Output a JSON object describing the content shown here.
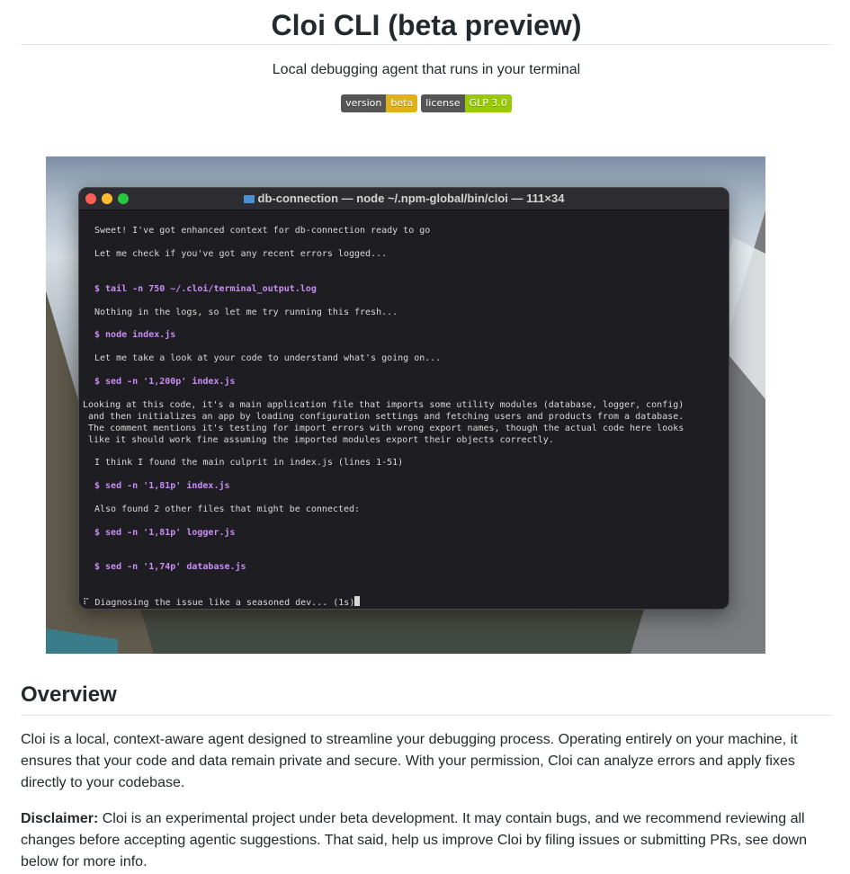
{
  "header": {
    "title": "Cloi CLI (beta preview)",
    "tagline": "Local debugging agent that runs in your terminal"
  },
  "badges": [
    {
      "label": "version",
      "value": "beta",
      "color": "#dfb317"
    },
    {
      "label": "license",
      "value": "GLP 3.0",
      "color": "#97ca00"
    }
  ],
  "terminal": {
    "title": "db-connection — node ~/.npm-global/bin/cloi — 111×34",
    "lines": [
      "Sweet! I've got enhanced context for db-connection ready to go",
      "Let me check if you've got any recent errors logged...",
      "$ tail -n 750 ~/.cloi/terminal_output.log",
      "Nothing in the logs, so let me try running this fresh...",
      "$ node index.js",
      "Let me take a look at your code to understand what's going on...",
      "$ sed -n '1,200p' index.js",
      "Looking at this code, it's a main application file that imports some utility modules (database, logger, config)",
      " and then initializes an app by loading configuration settings and fetching users and products from a database.",
      " The comment mentions it's testing for import errors with wrong export names, though the actual code here looks",
      " like it should work fine assuming the imported modules export their objects correctly.",
      "I think I found the main culprit in index.js (lines 1-51)",
      "$ sed -n '1,81p' index.js",
      "Also found 2 other files that might be connected:",
      "$ sed -n '1,81p' logger.js",
      "$ sed -n '1,74p' database.js",
      "Diagnosing the issue like a seasoned dev... (1s)"
    ],
    "spinner": "⠏",
    "command_color": "#c88cf5"
  },
  "overview": {
    "heading": "Overview",
    "paragraph": "Cloi is a local, context-aware agent designed to streamline your debugging process. Operating entirely on your machine, it ensures that your code and data remain private and secure. With your permission, Cloi can analyze errors and apply fixes directly to your codebase.",
    "disclaimer_label": "Disclaimer:",
    "disclaimer_text": " Cloi is an experimental project under beta development. It may contain bugs, and we recommend reviewing all changes before accepting agentic suggestions. That said, help us improve Cloi by filing issues or submitting PRs, see down below for more info."
  }
}
